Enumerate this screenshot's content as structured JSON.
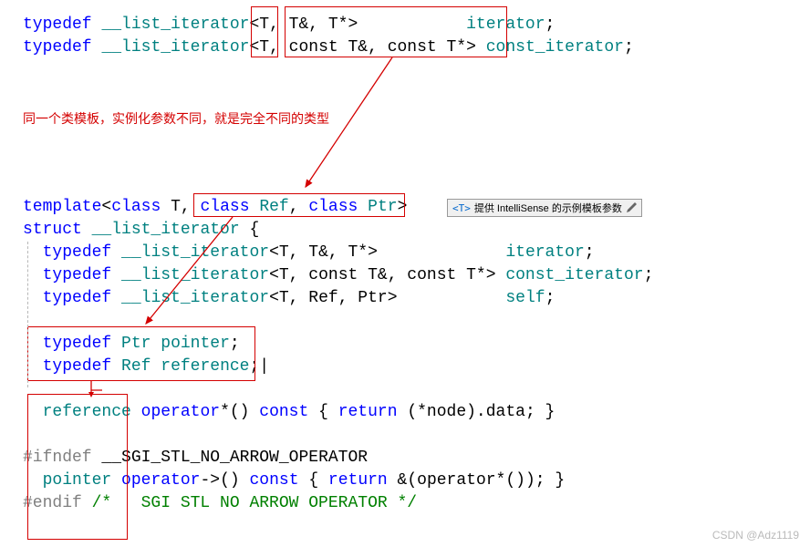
{
  "lines": {
    "l1_typedef": "typedef",
    "l1_iter": "__list_iterator",
    "l1_tpl": "<T, T&, T*>",
    "l1_name": "iterator",
    "l2_typedef": "typedef",
    "l2_iter": "__list_iterator",
    "l2_tpl": "<T, const T&, const T*>",
    "l2_name": "const_iterator",
    "annotation": "同一个类模板，实例化参数不同，就是完全不同的类型",
    "template_kw": "template",
    "template_params_open": "<",
    "template_p1": "class T",
    "template_sep": ", ",
    "template_p2": "class Ref",
    "template_p3": "class Ptr",
    "template_params_close": ">",
    "struct_kw": "struct",
    "struct_name": "__list_iterator",
    "brace_open": " {",
    "td1_typedef": "typedef",
    "td1_iter": "__list_iterator",
    "td1_tpl": "<T, T&, T*>",
    "td1_name": "iterator",
    "td2_typedef": "typedef",
    "td2_iter": "__list_iterator",
    "td2_tpl": "<T, const T&, const T*> ",
    "td2_name": "const_iterator",
    "td3_typedef": "typedef",
    "td3_iter": "__list_iterator",
    "td3_tpl": "<T, Ref, Ptr>",
    "td3_name": "self",
    "td4_typedef": "typedef",
    "td4_type": "Ptr",
    "td4_name": "pointer",
    "td5_typedef": "typedef",
    "td5_type": "Ref",
    "td5_name": "reference",
    "op1_ret": "reference",
    "op1_kw": "operator",
    "op1_sym": "*()",
    "op1_const": "const",
    "op1_body_open": " { ",
    "op1_return": "return",
    "op1_expr": " (*node).data; }",
    "ifndef": "#ifndef",
    "ifndef_macro": " __SGI_STL_NO_ARROW_OPERATOR",
    "op2_ret": "pointer",
    "op2_kw": "operator",
    "op2_sym": "->()",
    "op2_const": "const",
    "op2_body_open": " { ",
    "op2_return": "return",
    "op2_expr": " &(operator*()); }",
    "endif": "#endif",
    "endif_comment": " /*   SGI STL NO ARROW OPERATOR */"
  },
  "intellisense": {
    "badge": "<T>",
    "text": "提供 IntelliSense 的示例模板参数"
  },
  "watermark": "CSDN @Adz1119"
}
